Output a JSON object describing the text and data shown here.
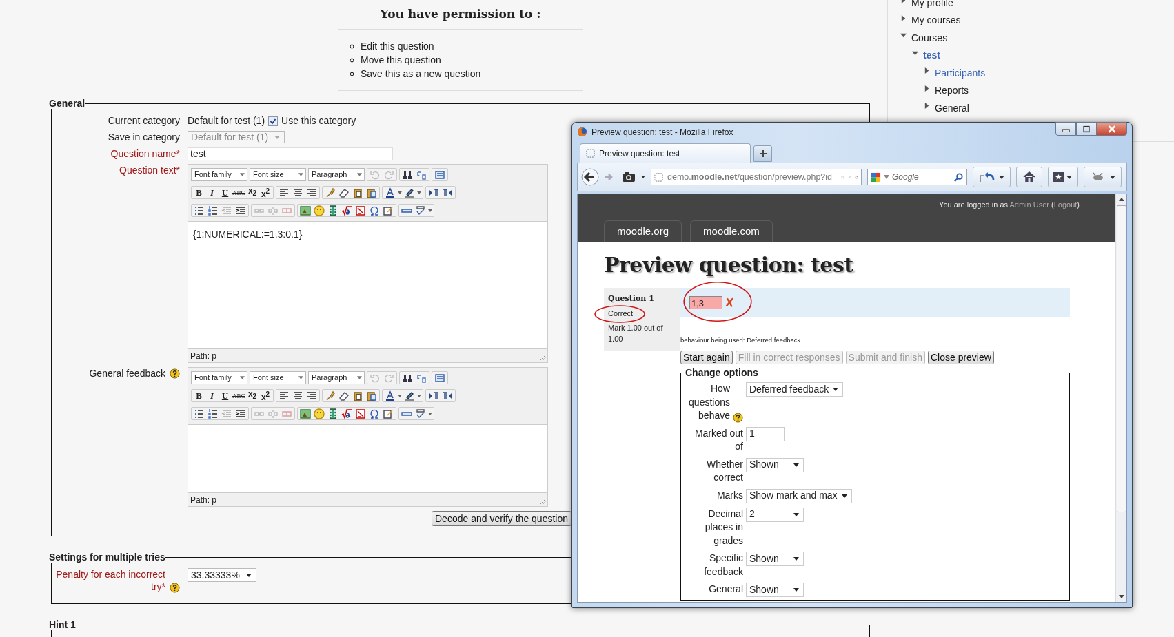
{
  "heading": "You have permission to :",
  "permissions": [
    "Edit this question",
    "Move this question",
    "Save this as a new question"
  ],
  "general": {
    "legend": "General",
    "current_category": {
      "label": "Current category",
      "value": "Default for test (1)",
      "checkbox": {
        "label": "Use this category",
        "checked": true
      }
    },
    "save_in_category": {
      "label": "Save in category",
      "value": "Default for test (1)",
      "disabled": true
    },
    "question_name": {
      "label": "Question name*",
      "required": true,
      "value": "test"
    },
    "editors": [
      {
        "label": "Question text*",
        "required": true,
        "help": false,
        "selects": [
          "Font family",
          "Font size",
          "Paragraph"
        ],
        "format_buttons": [
          {
            "label": "B",
            "kind": "bold"
          },
          {
            "label": "I",
            "kind": "italic"
          },
          {
            "label": "U",
            "kind": "underline"
          },
          {
            "label": "ABC",
            "kind": "strike"
          },
          {
            "label": "x$_{2}$",
            "kind": "sub"
          },
          {
            "label": "x$^{2}$",
            "kind": "sup"
          }
        ],
        "content": "{1:NUMERICAL:=1.3:0.1}",
        "path": "Path: p"
      },
      {
        "label": "General feedback",
        "required": false,
        "help": true,
        "selects": [
          "Font family",
          "Font size",
          "Paragraph"
        ],
        "format_buttons": [
          {
            "label": "B",
            "kind": "bold"
          },
          {
            "label": "I",
            "kind": "italic"
          },
          {
            "label": "U",
            "kind": "underline"
          },
          {
            "label": "ABC",
            "kind": "strike"
          },
          {
            "label": "x$_{2}$",
            "kind": "sub"
          },
          {
            "label": "x$^{2}$",
            "kind": "sup"
          }
        ],
        "path": "Path: p"
      }
    ],
    "decode_button": "Decode and verify the question"
  },
  "multiple_tries": {
    "legend": "Settings for multiple tries",
    "penalty": {
      "label": "Penalty for each incorrect try*",
      "required": true,
      "help": true,
      "value": "33.33333%"
    }
  },
  "hint": {
    "legend": "Hint 1"
  },
  "sidebar": {
    "items": [
      {
        "label": "My profile",
        "expanded": false,
        "link": false,
        "selected": false
      },
      {
        "label": "My courses",
        "expanded": false,
        "link": false,
        "selected": false
      },
      {
        "label": "Courses",
        "expanded": true,
        "link": false,
        "selected": false,
        "children": [
          {
            "label": "test",
            "expanded": true,
            "link": true,
            "selected": true,
            "children": [
              {
                "label": "Participants",
                "expanded": false,
                "link": true,
                "selected": false
              },
              {
                "label": "Reports",
                "expanded": false,
                "link": false,
                "selected": false
              },
              {
                "label": "General",
                "expanded": false,
                "link": false,
                "selected": false
              }
            ]
          }
        ]
      }
    ]
  },
  "browser": {
    "title": "Preview question: test - Mozilla Firefox",
    "tab": "Preview question: test",
    "url": "demo.**moodle.net**/question/preview.php?id=",
    "search_placeholder": "Google",
    "page": {
      "login": [
        {
          "text": "You are logged in as ",
          "link": false
        },
        {
          "text": "Admin User",
          "link": true
        },
        {
          "text": " (",
          "link": false
        },
        {
          "text": "Logout",
          "link": true
        },
        {
          "text": ")",
          "link": false
        }
      ],
      "site_tabs": [
        "moodle.org",
        "moodle.com"
      ],
      "heading": "Preview question: test",
      "question": {
        "title": "Question 1",
        "state": "Correct",
        "mark": "Mark 1.00 out of 1.00",
        "answer": "1,3",
        "answer_correct": false
      },
      "behaviour": "behaviour being used: Deferred feedback",
      "buttons": [
        {
          "label": "Start again",
          "disabled": false
        },
        {
          "label": "Fill in correct responses",
          "disabled": true
        },
        {
          "label": "Submit and finish",
          "disabled": true
        },
        {
          "label": "Close preview",
          "disabled": false
        }
      ],
      "options": {
        "legend": "Change options",
        "rows": [
          {
            "label": "How questions behave",
            "kind": "select",
            "value": "Deferred feedback",
            "help": true
          },
          {
            "label": "Marked out of",
            "kind": "text",
            "value": "1",
            "help": false
          },
          {
            "label": "Whether correct",
            "kind": "select",
            "value": "Shown",
            "help": false
          },
          {
            "label": "Marks",
            "kind": "select",
            "value": "Show mark and max",
            "help": false
          },
          {
            "label": "Decimal places in grades",
            "kind": "select",
            "value": "2",
            "help": false
          },
          {
            "label": "Specific feedback",
            "kind": "select",
            "value": "Shown",
            "help": false
          },
          {
            "label": "General",
            "kind": "select",
            "value": "Shown",
            "help": false
          }
        ]
      }
    }
  }
}
